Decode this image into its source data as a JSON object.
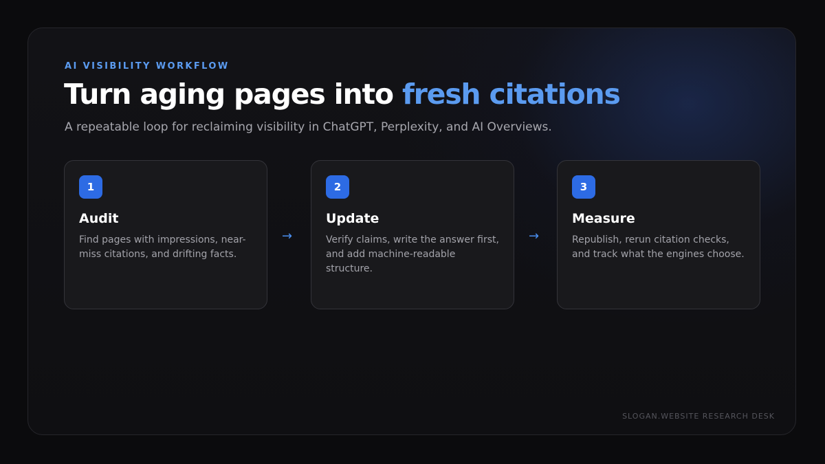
{
  "eyebrow": "AI VISIBILITY WORKFLOW",
  "title": {
    "main": "Turn aging pages into ",
    "accent": "fresh citations"
  },
  "subtitle": "A repeatable loop for reclaiming visibility in ChatGPT, Perplexity, and AI Overviews.",
  "steps": [
    {
      "number": "1",
      "title": "Audit",
      "description": "Find pages with impressions, near-miss citations, and drifting facts."
    },
    {
      "number": "2",
      "title": "Update",
      "description": "Verify claims, write the answer first, and add machine-readable structure."
    },
    {
      "number": "3",
      "title": "Measure",
      "description": "Republish, rerun citation checks, and track what the engines choose."
    }
  ],
  "arrows": [
    "→",
    "→"
  ],
  "footer": "SLOGAN.WEBSITE RESEARCH DESK",
  "colors": {
    "accent": "#5b9bf0",
    "badge": "#2d6be4",
    "background": "#0b0b0d",
    "card": "#19191c"
  }
}
